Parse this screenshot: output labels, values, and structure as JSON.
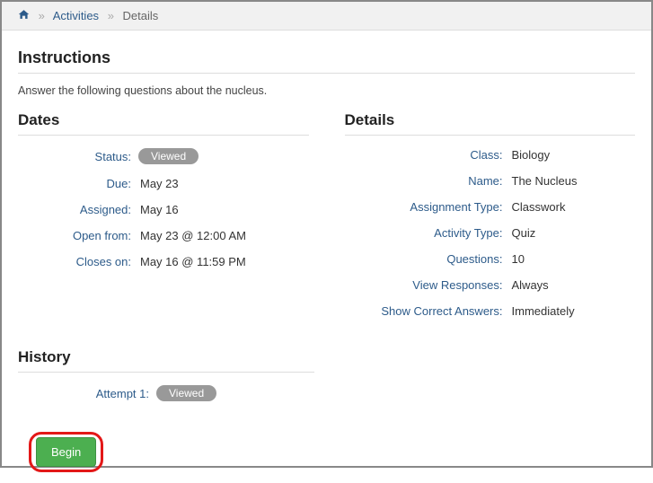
{
  "breadcrumb": {
    "home_icon": "home-icon",
    "activities": "Activities",
    "details": "Details"
  },
  "instructions": {
    "heading": "Instructions",
    "text": "Answer the following questions about the nucleus."
  },
  "dates": {
    "heading": "Dates",
    "status_label": "Status:",
    "status_value": "Viewed",
    "due_label": "Due:",
    "due_value": "May 23",
    "assigned_label": "Assigned:",
    "assigned_value": "May 16",
    "open_from_label": "Open from:",
    "open_from_value": "May 23 @ 12:00 AM",
    "closes_on_label": "Closes on:",
    "closes_on_value": "May 16 @ 11:59 PM"
  },
  "details": {
    "heading": "Details",
    "class_label": "Class:",
    "class_value": "Biology",
    "name_label": "Name:",
    "name_value": "The Nucleus",
    "assignment_type_label": "Assignment Type:",
    "assignment_type_value": "Classwork",
    "activity_type_label": "Activity Type:",
    "activity_type_value": "Quiz",
    "questions_label": "Questions:",
    "questions_value": "10",
    "view_responses_label": "View Responses:",
    "view_responses_value": "Always",
    "show_correct_label": "Show Correct Answers:",
    "show_correct_value": "Immediately"
  },
  "history": {
    "heading": "History",
    "attempt1_label": "Attempt 1:",
    "attempt1_value": "Viewed"
  },
  "actions": {
    "begin": "Begin"
  }
}
